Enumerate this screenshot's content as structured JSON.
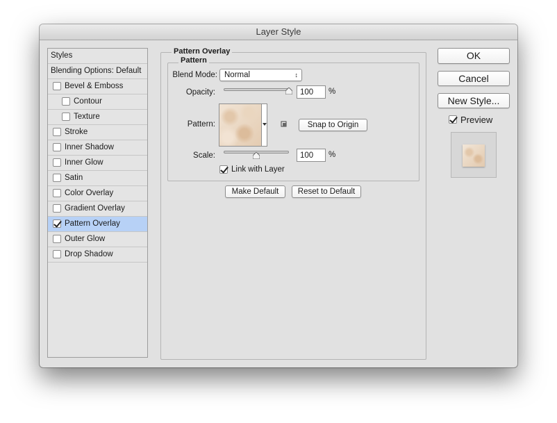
{
  "window": {
    "title": "Layer Style"
  },
  "styles_panel": {
    "header": "Styles",
    "blending_options": "Blending Options: Default",
    "items": [
      {
        "label": "Bevel & Emboss",
        "checked": false,
        "indent": false,
        "selected": false
      },
      {
        "label": "Contour",
        "checked": false,
        "indent": true,
        "selected": false
      },
      {
        "label": "Texture",
        "checked": false,
        "indent": true,
        "selected": false
      },
      {
        "label": "Stroke",
        "checked": false,
        "indent": false,
        "selected": false
      },
      {
        "label": "Inner Shadow",
        "checked": false,
        "indent": false,
        "selected": false
      },
      {
        "label": "Inner Glow",
        "checked": false,
        "indent": false,
        "selected": false
      },
      {
        "label": "Satin",
        "checked": false,
        "indent": false,
        "selected": false
      },
      {
        "label": "Color Overlay",
        "checked": false,
        "indent": false,
        "selected": false
      },
      {
        "label": "Gradient Overlay",
        "checked": false,
        "indent": false,
        "selected": false
      },
      {
        "label": "Pattern Overlay",
        "checked": true,
        "indent": false,
        "selected": true
      },
      {
        "label": "Outer Glow",
        "checked": false,
        "indent": false,
        "selected": false
      },
      {
        "label": "Drop Shadow",
        "checked": false,
        "indent": false,
        "selected": false
      }
    ],
    "selected_color": "#b7d1f6"
  },
  "pattern_overlay": {
    "group_title": "Pattern Overlay",
    "sub_group_title": "Pattern",
    "blend_mode_label": "Blend Mode:",
    "blend_mode_value": "Normal",
    "opacity_label": "Opacity:",
    "opacity_value": "100",
    "opacity_unit": "%",
    "opacity_level": 1.0,
    "pattern_label": "Pattern:",
    "new_preset_icon": "new-preset-icon",
    "snap_to_origin": "Snap to Origin",
    "scale_label": "Scale:",
    "scale_value": "100",
    "scale_unit": "%",
    "scale_level": 0.5,
    "link_with_layer_label": "Link with Layer",
    "link_with_layer_checked": true,
    "make_default": "Make Default",
    "reset_to_default": "Reset to Default"
  },
  "right_panel": {
    "ok": "OK",
    "cancel": "Cancel",
    "new_style": "New Style...",
    "preview_label": "Preview",
    "preview_checked": true
  }
}
